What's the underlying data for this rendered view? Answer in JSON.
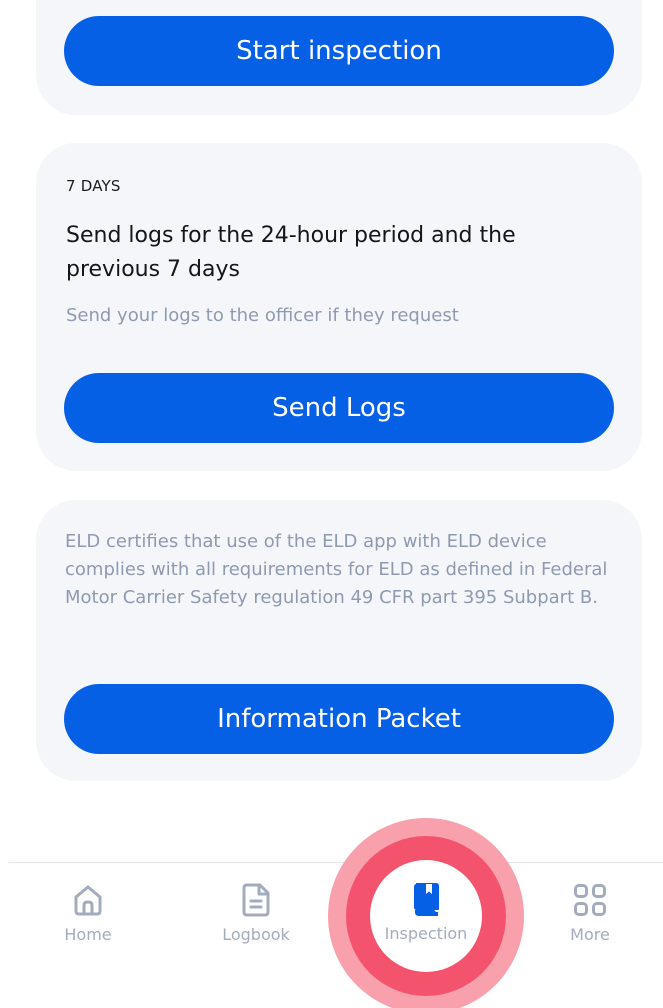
{
  "cards": {
    "inspection": {
      "button_label": "Start inspection"
    },
    "seven_days": {
      "eyebrow": "7 DAYS",
      "title": "Send logs for the 24-hour period and the previous 7 days",
      "subtitle": "Send your logs to the officer if they request",
      "button_label": "Send Logs"
    },
    "info": {
      "text": "ELD certifies that use of the ELD app with ELD device complies with all requirements for ELD as defined in Federal Motor Carrier Safety regulation 49 CFR part 395 Subpart B.",
      "button_label": "Information Packet"
    }
  },
  "bottom_nav": {
    "items": [
      {
        "label": "Home",
        "icon": "home-icon"
      },
      {
        "label": "Logbook",
        "icon": "document-icon"
      },
      {
        "label": "Inspection",
        "icon": "book-icon",
        "active": true
      },
      {
        "label": "More",
        "icon": "grid-icon"
      }
    ]
  },
  "colors": {
    "primary": "#0660e6",
    "card_bg": "#f5f6fa",
    "muted_text": "#8e9ab0",
    "nav_inactive": "#a3acbd",
    "tap_highlight": "#f4536e"
  }
}
